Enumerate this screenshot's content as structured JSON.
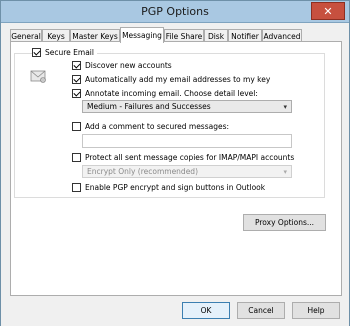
{
  "window": {
    "title": "PGP Options",
    "close_glyph": "✕"
  },
  "tabs": [
    {
      "label": "General"
    },
    {
      "label": "Keys"
    },
    {
      "label": "Master Keys"
    },
    {
      "label": "Messaging"
    },
    {
      "label": "File Share"
    },
    {
      "label": "Disk"
    },
    {
      "label": "Notifier"
    },
    {
      "label": "Advanced"
    }
  ],
  "messaging": {
    "secure_email_label": "Secure Email",
    "discover_label": "Discover new accounts",
    "auto_add_label": "Automatically add my email addresses to my key",
    "annotate_label": "Annotate incoming email.  Choose detail level:",
    "detail_level_value": "Medium - Failures and Successes",
    "add_comment_label": "Add a comment to secured messages:",
    "comment_value": "",
    "protect_copies_label": "Protect all sent message copies for IMAP/MAPI accounts",
    "encrypt_mode_value": "Encrypt Only (recommended)",
    "enable_buttons_label": "Enable PGP encrypt and sign buttons in Outlook",
    "proxy_button": "Proxy Options..."
  },
  "footer": {
    "ok": "OK",
    "cancel": "Cancel",
    "help": "Help"
  },
  "icons": {
    "envelope": "envelope-lock-icon"
  }
}
